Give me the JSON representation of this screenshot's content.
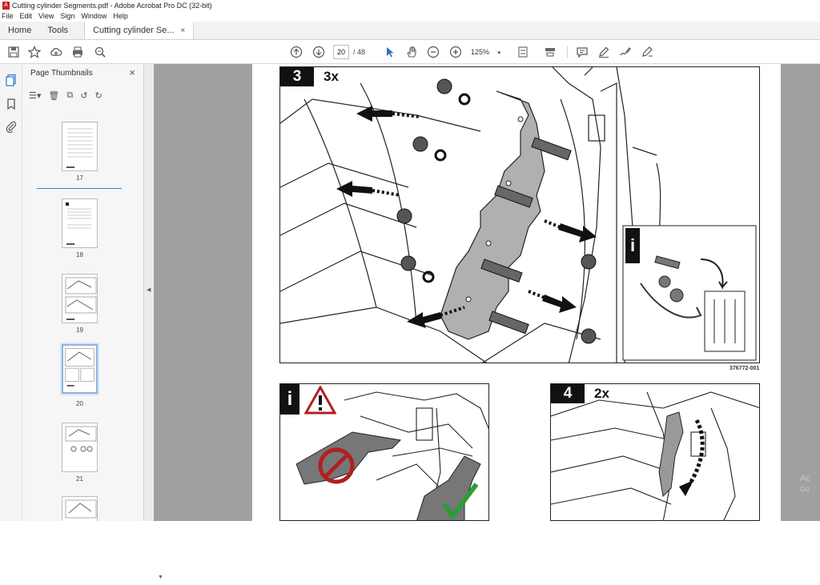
{
  "window": {
    "title": "Cutting cylinder Segments.pdf - Adobe Acrobat Pro DC (32-bit)"
  },
  "menu": [
    "File",
    "Edit",
    "View",
    "Sign",
    "Window",
    "Help"
  ],
  "tabs": {
    "home": "Home",
    "tools": "Tools",
    "document": "Cutting cylinder Se...",
    "close_symbol": "×"
  },
  "toolbar": {
    "current_page": "20",
    "page_total": "/ 48",
    "zoom": "125%"
  },
  "panel": {
    "title": "Page Thumbnails",
    "close_symbol": "×",
    "thumbnails": [
      {
        "label": "17"
      },
      {
        "label": "18"
      },
      {
        "label": "19"
      },
      {
        "label": "20",
        "selected": true
      },
      {
        "label": "21"
      }
    ]
  },
  "document": {
    "top_step": {
      "number": "3",
      "count": "3x",
      "ref_code": "376772-001",
      "info_icon": "i"
    },
    "bottom_left": {
      "info_icon": "i",
      "warning_icon": "warning-triangle-icon"
    },
    "bottom_right": {
      "number": "4",
      "count": "2x"
    }
  },
  "overlay": {
    "watermark": "Ac",
    "watermark_line2": "Go"
  },
  "colors": {
    "acrobat_red": "#c8201c",
    "selection_blue": "#2f7fd0",
    "doc_background": "#a0a0a0",
    "warning_red": "#b02020",
    "check_green": "#2e9b3a"
  }
}
